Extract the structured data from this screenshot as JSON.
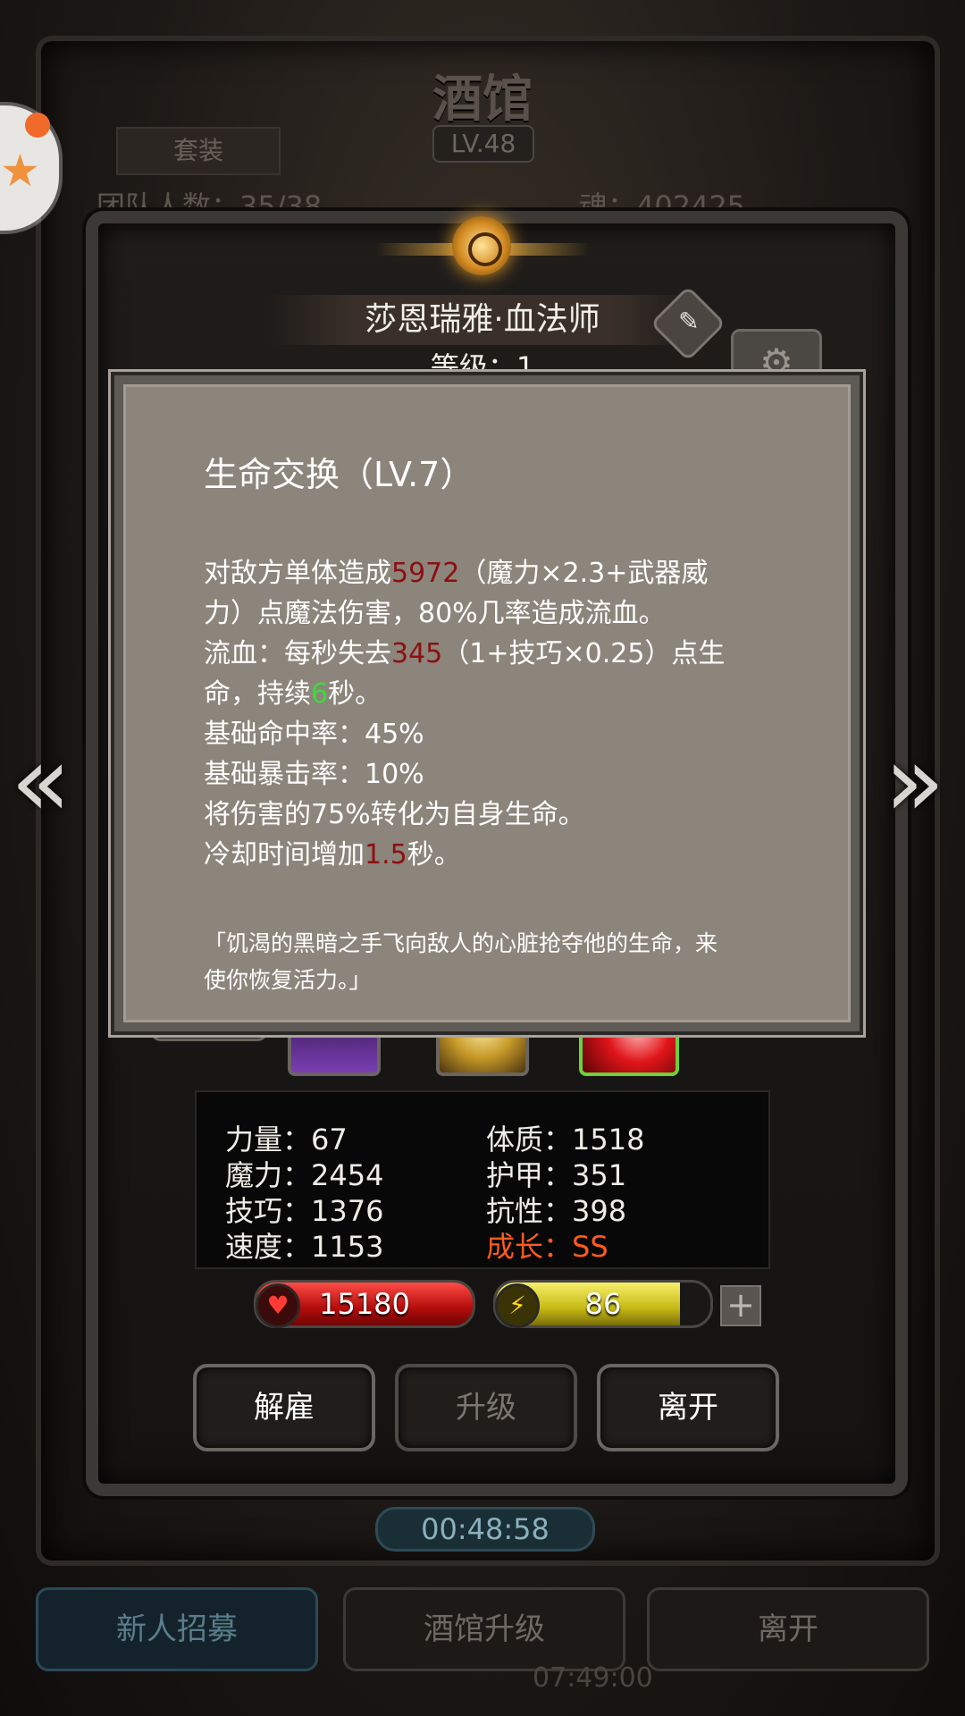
{
  "background": {
    "tavern_title": "酒馆",
    "tavern_level": "LV.48",
    "suit_button": "套装",
    "members_text": "团队人数：35/38",
    "soul_text": "魂：402425",
    "timer": "00:48:58",
    "bottom_buttons": [
      "新人招募",
      "酒馆升级",
      "离开"
    ],
    "bottom_time": "07:49:00"
  },
  "hero": {
    "name": "莎恩瑞雅·血法师",
    "level_text": "等级：1"
  },
  "tooltip": {
    "title": "生命交换（LV.7）",
    "line1_pre": "对敌方单体造成",
    "line1_val": "5972",
    "line1_post": "（魔力×2.3+武器威",
    "line2": "力）点魔法伤害，80%几率造成流血。",
    "line3_pre": "流血：每秒失去",
    "line3_val": "345",
    "line3_post": "（1+技巧×0.25）点生",
    "line4_pre": "命，持续",
    "line4_val": "6",
    "line4_post": "秒。",
    "line5": "基础命中率：45%",
    "line6": "基础暴击率：10%",
    "line7": "将伤害的75%转化为自身生命。",
    "line8_pre": "冷却时间增加",
    "line8_val": "1.5",
    "line8_post": "秒。",
    "quote1": "「饥渴的黑暗之手飞向敌人的心脏抢夺他的生命，来",
    "quote2": "使你恢复活力。」"
  },
  "stats": {
    "strength": "力量：67",
    "magic": "魔力：2454",
    "skill": "技巧：1376",
    "speed": "速度：1153",
    "constitution": "体质：1518",
    "armor": "护甲：351",
    "resistance": "抗性：398",
    "growth": "成长：SS"
  },
  "bars": {
    "hp": "15180",
    "hp_fill": 1.0,
    "energy": "86",
    "energy_fill": 0.86
  },
  "actions": {
    "dismiss": "解雇",
    "upgrade": "升级",
    "leave": "离开"
  },
  "colors": {
    "damage_value": "#8e0f10",
    "duration_value": "#3ddc3a",
    "growth": "#ff5a1f"
  }
}
